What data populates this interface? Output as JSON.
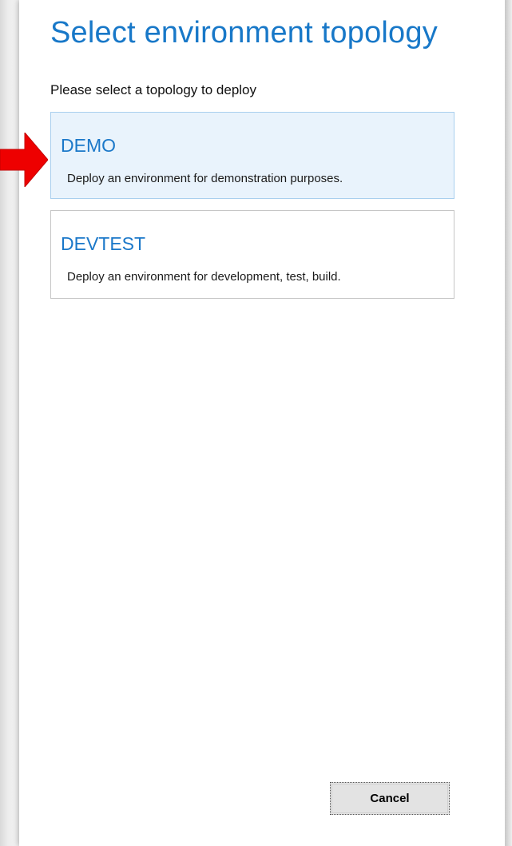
{
  "dialog": {
    "title": "Select environment topology",
    "instruction": "Please select a topology to deploy"
  },
  "options": [
    {
      "name": "DEMO",
      "description": "Deploy an environment for demonstration purposes.",
      "selected": true
    },
    {
      "name": "DEVTEST",
      "description": "Deploy an environment for development, test, build.",
      "selected": false
    }
  ],
  "footer": {
    "cancel_label": "Cancel"
  },
  "annotation": {
    "icon": "arrow-right-icon",
    "color": "#ee0000"
  },
  "colors": {
    "accent": "#1878c8",
    "selected_bg": "#e9f3fc",
    "selected_border": "#a9cfee"
  }
}
